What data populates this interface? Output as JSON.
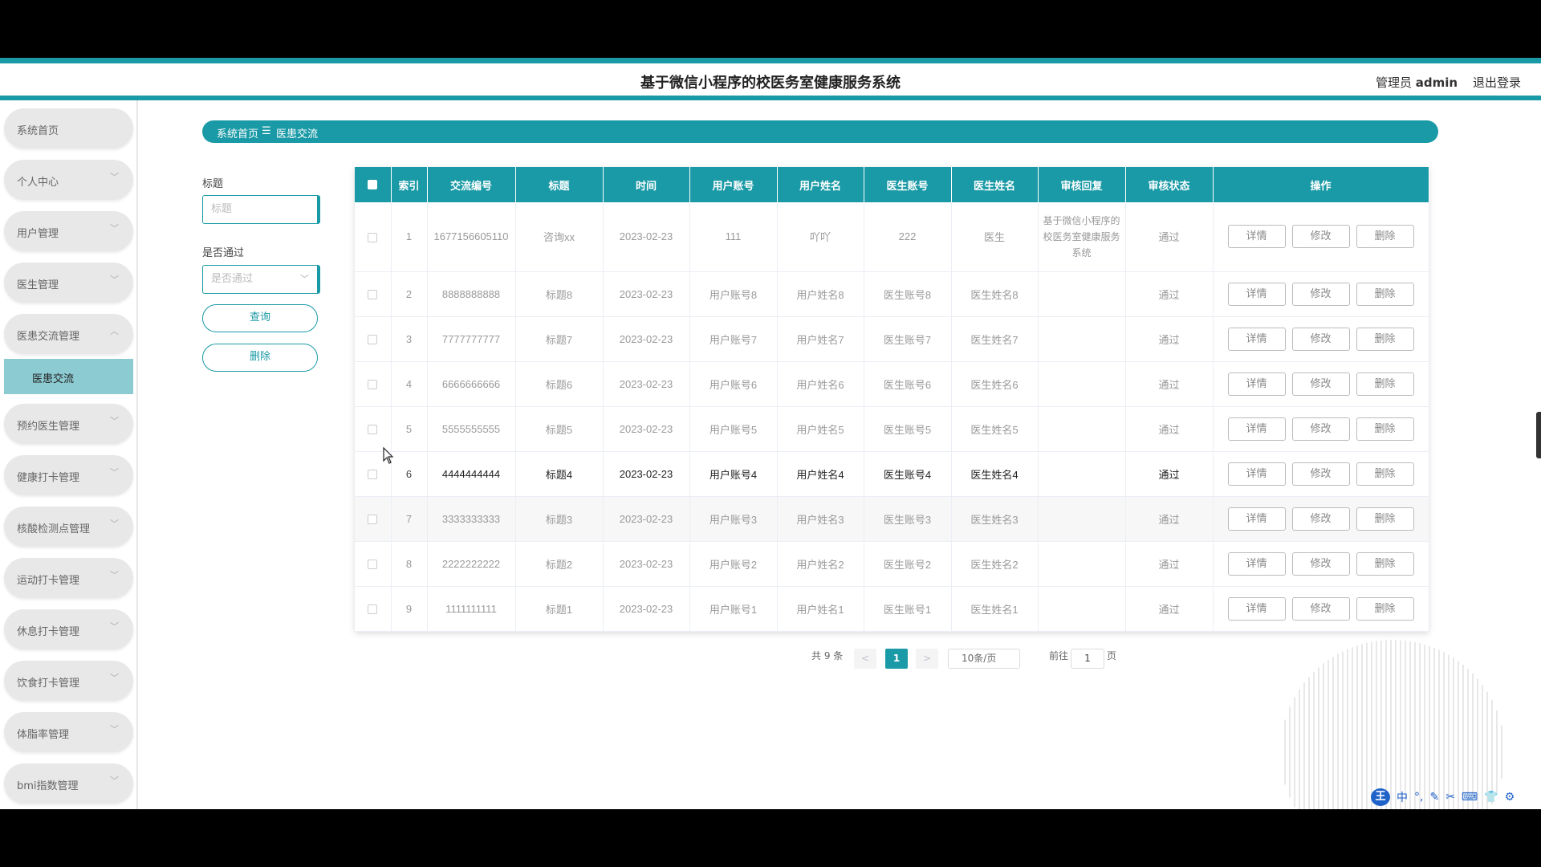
{
  "header": {
    "title": "基于微信小程序的校医务室健康服务系统",
    "admin_prefix": "管理员",
    "admin_name": "admin",
    "logout": "退出登录"
  },
  "sidebar": {
    "items": [
      {
        "label": "系统首页"
      },
      {
        "label": "个人中心"
      },
      {
        "label": "用户管理"
      },
      {
        "label": "医生管理"
      },
      {
        "label": "医患交流管理"
      },
      {
        "label": "预约医生管理"
      },
      {
        "label": "健康打卡管理"
      },
      {
        "label": "核酸检测点管理"
      },
      {
        "label": "运动打卡管理"
      },
      {
        "label": "休息打卡管理"
      },
      {
        "label": "饮食打卡管理"
      },
      {
        "label": "体脂率管理"
      },
      {
        "label": "bmi指数管理"
      }
    ],
    "submenu": {
      "label": "医患交流"
    }
  },
  "breadcrumb": {
    "home": "系统首页",
    "sep": "☰",
    "current": "医患交流"
  },
  "filters": {
    "title_label": "标题",
    "title_placeholder": "标题",
    "pass_label": "是否通过",
    "pass_placeholder": "是否通过",
    "query_button": "查询",
    "delete_button": "删除"
  },
  "table": {
    "headers": [
      "索引",
      "交流编号",
      "标题",
      "时间",
      "用户账号",
      "用户姓名",
      "医生账号",
      "医生姓名",
      "审核回复",
      "审核状态",
      "操作"
    ],
    "actions": {
      "detail": "详情",
      "edit": "修改",
      "delete": "删除"
    },
    "rows": [
      {
        "idx": "1",
        "code": "1677156605110",
        "title": "咨询xx",
        "time": "2023-02-23",
        "user_account": "111",
        "user_name": "吖吖",
        "doctor_account": "222",
        "doctor_name": "医生",
        "reply": "基于微信小程序的校医务室健康服务系统",
        "status": "通过"
      },
      {
        "idx": "2",
        "code": "8888888888",
        "title": "标题8",
        "time": "2023-02-23",
        "user_account": "用户账号8",
        "user_name": "用户姓名8",
        "doctor_account": "医生账号8",
        "doctor_name": "医生姓名8",
        "reply": "",
        "status": "通过"
      },
      {
        "idx": "3",
        "code": "7777777777",
        "title": "标题7",
        "time": "2023-02-23",
        "user_account": "用户账号7",
        "user_name": "用户姓名7",
        "doctor_account": "医生账号7",
        "doctor_name": "医生姓名7",
        "reply": "",
        "status": "通过"
      },
      {
        "idx": "4",
        "code": "6666666666",
        "title": "标题6",
        "time": "2023-02-23",
        "user_account": "用户账号6",
        "user_name": "用户姓名6",
        "doctor_account": "医生账号6",
        "doctor_name": "医生姓名6",
        "reply": "",
        "status": "通过"
      },
      {
        "idx": "5",
        "code": "5555555555",
        "title": "标题5",
        "time": "2023-02-23",
        "user_account": "用户账号5",
        "user_name": "用户姓名5",
        "doctor_account": "医生账号5",
        "doctor_name": "医生姓名5",
        "reply": "",
        "status": "通过"
      },
      {
        "idx": "6",
        "code": "4444444444",
        "title": "标题4",
        "time": "2023-02-23",
        "user_account": "用户账号4",
        "user_name": "用户姓名4",
        "doctor_account": "医生账号4",
        "doctor_name": "医生姓名4",
        "reply": "",
        "status": "通过"
      },
      {
        "idx": "7",
        "code": "3333333333",
        "title": "标题3",
        "time": "2023-02-23",
        "user_account": "用户账号3",
        "user_name": "用户姓名3",
        "doctor_account": "医生账号3",
        "doctor_name": "医生姓名3",
        "reply": "",
        "status": "通过"
      },
      {
        "idx": "8",
        "code": "2222222222",
        "title": "标题2",
        "time": "2023-02-23",
        "user_account": "用户账号2",
        "user_name": "用户姓名2",
        "doctor_account": "医生账号2",
        "doctor_name": "医生姓名2",
        "reply": "",
        "status": "通过"
      },
      {
        "idx": "9",
        "code": "1111111111",
        "title": "标题1",
        "time": "2023-02-23",
        "user_account": "用户账号1",
        "user_name": "用户姓名1",
        "doctor_account": "医生账号1",
        "doctor_name": "医生姓名1",
        "reply": "",
        "status": "通过"
      }
    ]
  },
  "pagination": {
    "total": "共 9 条",
    "prev": "<",
    "current": "1",
    "next": ">",
    "page_size": "10条/页",
    "goto_label": "前往",
    "goto_value": "1",
    "page_suffix": "页"
  },
  "ime_toolbar": {
    "logo": "王",
    "mode": "中",
    "icons": [
      "°,",
      "✎",
      "✂",
      "⌨",
      "👕",
      "⚙"
    ]
  },
  "colors": {
    "accent": "#1a9aa6",
    "submenu_bg": "#8ccbd2",
    "menu_bg": "#e8e8e8",
    "ime_blue": "#1f63c9"
  }
}
